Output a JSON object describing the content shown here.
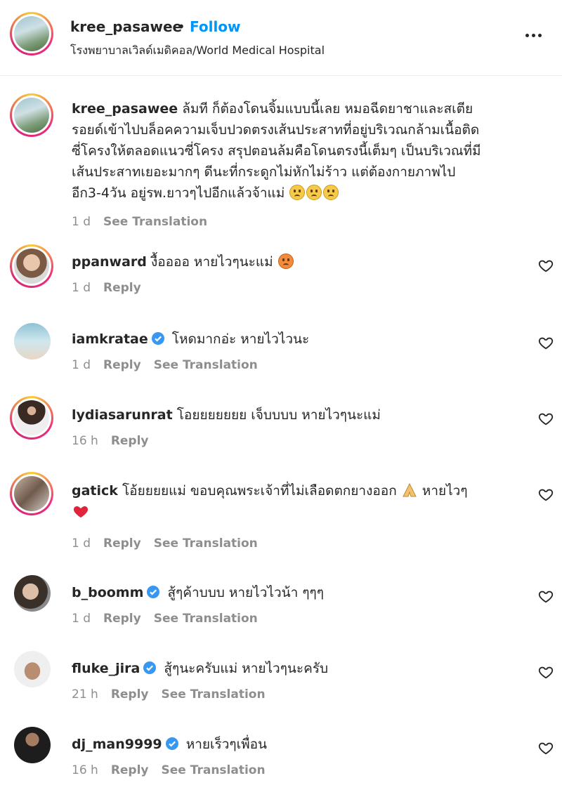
{
  "post": {
    "username": "kree_pasawee",
    "dot": "•",
    "follow_label": "Follow",
    "location": "โรงพยาบาลเวิลด์เมดิคอล/World Medical Hospital"
  },
  "caption": {
    "username": "kree_pasawee",
    "lines": [
      "ล้มที ก็ต้องโดนจิ้มแบบนี้เลย หมอฉีดยาชาและสเตีย",
      "รอยด์เข้าไปบล็อคความเจ็บปวดตรงเส้นประสาทที่อยู่บริเวณกล้ามเนื้อติด",
      "ซี่โครงให้ตลอดแนวซี่โครง สรุปตอนล้มคือโดนตรงนี้เต็มๆ เป็นบริเวณที่มี",
      "เส้นประสาทเยอะมากๆ ดีนะที่กระดูกไม่หักไม่ร้าว แต่ต้องกายภาพไป",
      "อีก3-4วัน อยู่รพ.ยาวๆไปอีกแล้วจ้าแม่"
    ],
    "time": "1 d",
    "see_translation": "See Translation"
  },
  "comments": [
    {
      "username": "ppanward",
      "text": "งื้ออออ หายไวๆนะแม่",
      "time": "1 d",
      "reply": "Reply",
      "see_translation": "",
      "verified": false
    },
    {
      "username": "iamkratae",
      "text": "โหดมากอ่ะ หายไวไวนะ",
      "time": "1 d",
      "reply": "Reply",
      "see_translation": "See Translation",
      "verified": true
    },
    {
      "username": "lydiasarunrat",
      "text": "โอยยยยยยย เจ็บบบบ หายไวๆนะแม่",
      "time": "16 h",
      "reply": "Reply",
      "see_translation": "",
      "verified": false
    },
    {
      "username": "gatick",
      "text": "โอ้ยยยยแม่ ขอบคุณพระเจ้าที่ไม่เลือดตกยางออก",
      "text2": "หายไวๆ",
      "time": "1 d",
      "reply": "Reply",
      "see_translation": "See Translation",
      "verified": false
    },
    {
      "username": "b_boomm",
      "text": "สู้ๆค้าบบบ หายไวไวน้า ๆๆๆ",
      "time": "1 d",
      "reply": "Reply",
      "see_translation": "See Translation",
      "verified": true
    },
    {
      "username": "fluke_jira",
      "text": "สู้ๆนะครับแม่ หายไวๆนะครับ",
      "time": "21 h",
      "reply": "Reply",
      "see_translation": "See Translation",
      "verified": true
    },
    {
      "username": "dj_man9999",
      "text": "หายเร็วๆเพื่อน",
      "time": "16 h",
      "reply": "Reply",
      "see_translation": "See Translation",
      "verified": true
    }
  ]
}
